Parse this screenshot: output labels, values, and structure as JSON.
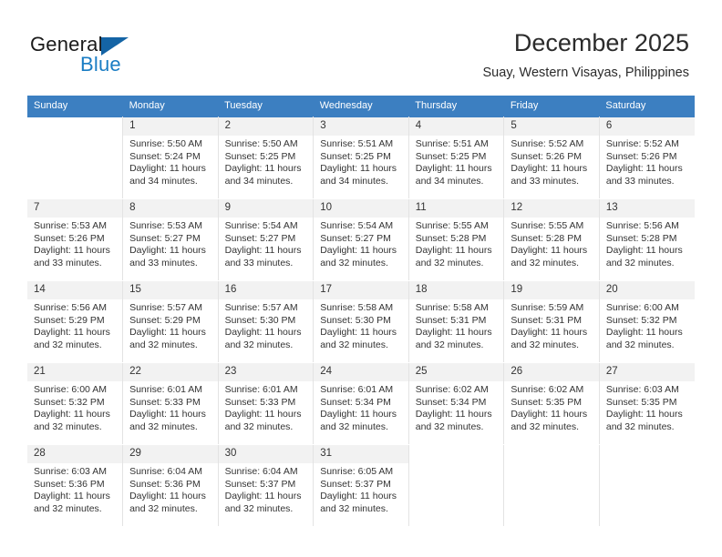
{
  "brand": {
    "name_part1": "General",
    "name_part2": "Blue"
  },
  "header": {
    "title": "December 2025",
    "location": "Suay, Western Visayas, Philippines"
  },
  "calendar": {
    "weekday_headers": [
      "Sunday",
      "Monday",
      "Tuesday",
      "Wednesday",
      "Thursday",
      "Friday",
      "Saturday"
    ],
    "accent_color": "#3c7fc1",
    "daynum_bg": "#f2f2f2",
    "weeks": [
      [
        {
          "day": "",
          "sunrise": "",
          "sunset": "",
          "daylight1": "",
          "daylight2": "",
          "blank": true
        },
        {
          "day": "1",
          "sunrise": "Sunrise: 5:50 AM",
          "sunset": "Sunset: 5:24 PM",
          "daylight1": "Daylight: 11 hours",
          "daylight2": "and 34 minutes."
        },
        {
          "day": "2",
          "sunrise": "Sunrise: 5:50 AM",
          "sunset": "Sunset: 5:25 PM",
          "daylight1": "Daylight: 11 hours",
          "daylight2": "and 34 minutes."
        },
        {
          "day": "3",
          "sunrise": "Sunrise: 5:51 AM",
          "sunset": "Sunset: 5:25 PM",
          "daylight1": "Daylight: 11 hours",
          "daylight2": "and 34 minutes."
        },
        {
          "day": "4",
          "sunrise": "Sunrise: 5:51 AM",
          "sunset": "Sunset: 5:25 PM",
          "daylight1": "Daylight: 11 hours",
          "daylight2": "and 34 minutes."
        },
        {
          "day": "5",
          "sunrise": "Sunrise: 5:52 AM",
          "sunset": "Sunset: 5:26 PM",
          "daylight1": "Daylight: 11 hours",
          "daylight2": "and 33 minutes."
        },
        {
          "day": "6",
          "sunrise": "Sunrise: 5:52 AM",
          "sunset": "Sunset: 5:26 PM",
          "daylight1": "Daylight: 11 hours",
          "daylight2": "and 33 minutes."
        }
      ],
      [
        {
          "day": "7",
          "sunrise": "Sunrise: 5:53 AM",
          "sunset": "Sunset: 5:26 PM",
          "daylight1": "Daylight: 11 hours",
          "daylight2": "and 33 minutes."
        },
        {
          "day": "8",
          "sunrise": "Sunrise: 5:53 AM",
          "sunset": "Sunset: 5:27 PM",
          "daylight1": "Daylight: 11 hours",
          "daylight2": "and 33 minutes."
        },
        {
          "day": "9",
          "sunrise": "Sunrise: 5:54 AM",
          "sunset": "Sunset: 5:27 PM",
          "daylight1": "Daylight: 11 hours",
          "daylight2": "and 33 minutes."
        },
        {
          "day": "10",
          "sunrise": "Sunrise: 5:54 AM",
          "sunset": "Sunset: 5:27 PM",
          "daylight1": "Daylight: 11 hours",
          "daylight2": "and 32 minutes."
        },
        {
          "day": "11",
          "sunrise": "Sunrise: 5:55 AM",
          "sunset": "Sunset: 5:28 PM",
          "daylight1": "Daylight: 11 hours",
          "daylight2": "and 32 minutes."
        },
        {
          "day": "12",
          "sunrise": "Sunrise: 5:55 AM",
          "sunset": "Sunset: 5:28 PM",
          "daylight1": "Daylight: 11 hours",
          "daylight2": "and 32 minutes."
        },
        {
          "day": "13",
          "sunrise": "Sunrise: 5:56 AM",
          "sunset": "Sunset: 5:28 PM",
          "daylight1": "Daylight: 11 hours",
          "daylight2": "and 32 minutes."
        }
      ],
      [
        {
          "day": "14",
          "sunrise": "Sunrise: 5:56 AM",
          "sunset": "Sunset: 5:29 PM",
          "daylight1": "Daylight: 11 hours",
          "daylight2": "and 32 minutes."
        },
        {
          "day": "15",
          "sunrise": "Sunrise: 5:57 AM",
          "sunset": "Sunset: 5:29 PM",
          "daylight1": "Daylight: 11 hours",
          "daylight2": "and 32 minutes."
        },
        {
          "day": "16",
          "sunrise": "Sunrise: 5:57 AM",
          "sunset": "Sunset: 5:30 PM",
          "daylight1": "Daylight: 11 hours",
          "daylight2": "and 32 minutes."
        },
        {
          "day": "17",
          "sunrise": "Sunrise: 5:58 AM",
          "sunset": "Sunset: 5:30 PM",
          "daylight1": "Daylight: 11 hours",
          "daylight2": "and 32 minutes."
        },
        {
          "day": "18",
          "sunrise": "Sunrise: 5:58 AM",
          "sunset": "Sunset: 5:31 PM",
          "daylight1": "Daylight: 11 hours",
          "daylight2": "and 32 minutes."
        },
        {
          "day": "19",
          "sunrise": "Sunrise: 5:59 AM",
          "sunset": "Sunset: 5:31 PM",
          "daylight1": "Daylight: 11 hours",
          "daylight2": "and 32 minutes."
        },
        {
          "day": "20",
          "sunrise": "Sunrise: 6:00 AM",
          "sunset": "Sunset: 5:32 PM",
          "daylight1": "Daylight: 11 hours",
          "daylight2": "and 32 minutes."
        }
      ],
      [
        {
          "day": "21",
          "sunrise": "Sunrise: 6:00 AM",
          "sunset": "Sunset: 5:32 PM",
          "daylight1": "Daylight: 11 hours",
          "daylight2": "and 32 minutes."
        },
        {
          "day": "22",
          "sunrise": "Sunrise: 6:01 AM",
          "sunset": "Sunset: 5:33 PM",
          "daylight1": "Daylight: 11 hours",
          "daylight2": "and 32 minutes."
        },
        {
          "day": "23",
          "sunrise": "Sunrise: 6:01 AM",
          "sunset": "Sunset: 5:33 PM",
          "daylight1": "Daylight: 11 hours",
          "daylight2": "and 32 minutes."
        },
        {
          "day": "24",
          "sunrise": "Sunrise: 6:01 AM",
          "sunset": "Sunset: 5:34 PM",
          "daylight1": "Daylight: 11 hours",
          "daylight2": "and 32 minutes."
        },
        {
          "day": "25",
          "sunrise": "Sunrise: 6:02 AM",
          "sunset": "Sunset: 5:34 PM",
          "daylight1": "Daylight: 11 hours",
          "daylight2": "and 32 minutes."
        },
        {
          "day": "26",
          "sunrise": "Sunrise: 6:02 AM",
          "sunset": "Sunset: 5:35 PM",
          "daylight1": "Daylight: 11 hours",
          "daylight2": "and 32 minutes."
        },
        {
          "day": "27",
          "sunrise": "Sunrise: 6:03 AM",
          "sunset": "Sunset: 5:35 PM",
          "daylight1": "Daylight: 11 hours",
          "daylight2": "and 32 minutes."
        }
      ],
      [
        {
          "day": "28",
          "sunrise": "Sunrise: 6:03 AM",
          "sunset": "Sunset: 5:36 PM",
          "daylight1": "Daylight: 11 hours",
          "daylight2": "and 32 minutes."
        },
        {
          "day": "29",
          "sunrise": "Sunrise: 6:04 AM",
          "sunset": "Sunset: 5:36 PM",
          "daylight1": "Daylight: 11 hours",
          "daylight2": "and 32 minutes."
        },
        {
          "day": "30",
          "sunrise": "Sunrise: 6:04 AM",
          "sunset": "Sunset: 5:37 PM",
          "daylight1": "Daylight: 11 hours",
          "daylight2": "and 32 minutes."
        },
        {
          "day": "31",
          "sunrise": "Sunrise: 6:05 AM",
          "sunset": "Sunset: 5:37 PM",
          "daylight1": "Daylight: 11 hours",
          "daylight2": "and 32 minutes."
        },
        {
          "day": "",
          "sunrise": "",
          "sunset": "",
          "daylight1": "",
          "daylight2": "",
          "blank": true
        },
        {
          "day": "",
          "sunrise": "",
          "sunset": "",
          "daylight1": "",
          "daylight2": "",
          "blank": true
        },
        {
          "day": "",
          "sunrise": "",
          "sunset": "",
          "daylight1": "",
          "daylight2": "",
          "blank": true
        }
      ]
    ]
  }
}
